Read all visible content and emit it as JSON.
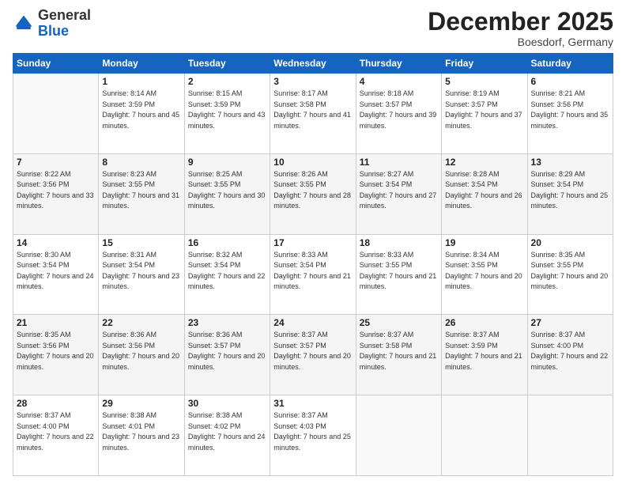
{
  "logo": {
    "general": "General",
    "blue": "Blue"
  },
  "header": {
    "month": "December 2025",
    "location": "Boesdorf, Germany"
  },
  "days_of_week": [
    "Sunday",
    "Monday",
    "Tuesday",
    "Wednesday",
    "Thursday",
    "Friday",
    "Saturday"
  ],
  "weeks": [
    [
      {
        "day": "",
        "sunrise": "",
        "sunset": "",
        "daylight": ""
      },
      {
        "day": "1",
        "sunrise": "Sunrise: 8:14 AM",
        "sunset": "Sunset: 3:59 PM",
        "daylight": "Daylight: 7 hours and 45 minutes."
      },
      {
        "day": "2",
        "sunrise": "Sunrise: 8:15 AM",
        "sunset": "Sunset: 3:59 PM",
        "daylight": "Daylight: 7 hours and 43 minutes."
      },
      {
        "day": "3",
        "sunrise": "Sunrise: 8:17 AM",
        "sunset": "Sunset: 3:58 PM",
        "daylight": "Daylight: 7 hours and 41 minutes."
      },
      {
        "day": "4",
        "sunrise": "Sunrise: 8:18 AM",
        "sunset": "Sunset: 3:57 PM",
        "daylight": "Daylight: 7 hours and 39 minutes."
      },
      {
        "day": "5",
        "sunrise": "Sunrise: 8:19 AM",
        "sunset": "Sunset: 3:57 PM",
        "daylight": "Daylight: 7 hours and 37 minutes."
      },
      {
        "day": "6",
        "sunrise": "Sunrise: 8:21 AM",
        "sunset": "Sunset: 3:56 PM",
        "daylight": "Daylight: 7 hours and 35 minutes."
      }
    ],
    [
      {
        "day": "7",
        "sunrise": "Sunrise: 8:22 AM",
        "sunset": "Sunset: 3:56 PM",
        "daylight": "Daylight: 7 hours and 33 minutes."
      },
      {
        "day": "8",
        "sunrise": "Sunrise: 8:23 AM",
        "sunset": "Sunset: 3:55 PM",
        "daylight": "Daylight: 7 hours and 31 minutes."
      },
      {
        "day": "9",
        "sunrise": "Sunrise: 8:25 AM",
        "sunset": "Sunset: 3:55 PM",
        "daylight": "Daylight: 7 hours and 30 minutes."
      },
      {
        "day": "10",
        "sunrise": "Sunrise: 8:26 AM",
        "sunset": "Sunset: 3:55 PM",
        "daylight": "Daylight: 7 hours and 28 minutes."
      },
      {
        "day": "11",
        "sunrise": "Sunrise: 8:27 AM",
        "sunset": "Sunset: 3:54 PM",
        "daylight": "Daylight: 7 hours and 27 minutes."
      },
      {
        "day": "12",
        "sunrise": "Sunrise: 8:28 AM",
        "sunset": "Sunset: 3:54 PM",
        "daylight": "Daylight: 7 hours and 26 minutes."
      },
      {
        "day": "13",
        "sunrise": "Sunrise: 8:29 AM",
        "sunset": "Sunset: 3:54 PM",
        "daylight": "Daylight: 7 hours and 25 minutes."
      }
    ],
    [
      {
        "day": "14",
        "sunrise": "Sunrise: 8:30 AM",
        "sunset": "Sunset: 3:54 PM",
        "daylight": "Daylight: 7 hours and 24 minutes."
      },
      {
        "day": "15",
        "sunrise": "Sunrise: 8:31 AM",
        "sunset": "Sunset: 3:54 PM",
        "daylight": "Daylight: 7 hours and 23 minutes."
      },
      {
        "day": "16",
        "sunrise": "Sunrise: 8:32 AM",
        "sunset": "Sunset: 3:54 PM",
        "daylight": "Daylight: 7 hours and 22 minutes."
      },
      {
        "day": "17",
        "sunrise": "Sunrise: 8:33 AM",
        "sunset": "Sunset: 3:54 PM",
        "daylight": "Daylight: 7 hours and 21 minutes."
      },
      {
        "day": "18",
        "sunrise": "Sunrise: 8:33 AM",
        "sunset": "Sunset: 3:55 PM",
        "daylight": "Daylight: 7 hours and 21 minutes."
      },
      {
        "day": "19",
        "sunrise": "Sunrise: 8:34 AM",
        "sunset": "Sunset: 3:55 PM",
        "daylight": "Daylight: 7 hours and 20 minutes."
      },
      {
        "day": "20",
        "sunrise": "Sunrise: 8:35 AM",
        "sunset": "Sunset: 3:55 PM",
        "daylight": "Daylight: 7 hours and 20 minutes."
      }
    ],
    [
      {
        "day": "21",
        "sunrise": "Sunrise: 8:35 AM",
        "sunset": "Sunset: 3:56 PM",
        "daylight": "Daylight: 7 hours and 20 minutes."
      },
      {
        "day": "22",
        "sunrise": "Sunrise: 8:36 AM",
        "sunset": "Sunset: 3:56 PM",
        "daylight": "Daylight: 7 hours and 20 minutes."
      },
      {
        "day": "23",
        "sunrise": "Sunrise: 8:36 AM",
        "sunset": "Sunset: 3:57 PM",
        "daylight": "Daylight: 7 hours and 20 minutes."
      },
      {
        "day": "24",
        "sunrise": "Sunrise: 8:37 AM",
        "sunset": "Sunset: 3:57 PM",
        "daylight": "Daylight: 7 hours and 20 minutes."
      },
      {
        "day": "25",
        "sunrise": "Sunrise: 8:37 AM",
        "sunset": "Sunset: 3:58 PM",
        "daylight": "Daylight: 7 hours and 21 minutes."
      },
      {
        "day": "26",
        "sunrise": "Sunrise: 8:37 AM",
        "sunset": "Sunset: 3:59 PM",
        "daylight": "Daylight: 7 hours and 21 minutes."
      },
      {
        "day": "27",
        "sunrise": "Sunrise: 8:37 AM",
        "sunset": "Sunset: 4:00 PM",
        "daylight": "Daylight: 7 hours and 22 minutes."
      }
    ],
    [
      {
        "day": "28",
        "sunrise": "Sunrise: 8:37 AM",
        "sunset": "Sunset: 4:00 PM",
        "daylight": "Daylight: 7 hours and 22 minutes."
      },
      {
        "day": "29",
        "sunrise": "Sunrise: 8:38 AM",
        "sunset": "Sunset: 4:01 PM",
        "daylight": "Daylight: 7 hours and 23 minutes."
      },
      {
        "day": "30",
        "sunrise": "Sunrise: 8:38 AM",
        "sunset": "Sunset: 4:02 PM",
        "daylight": "Daylight: 7 hours and 24 minutes."
      },
      {
        "day": "31",
        "sunrise": "Sunrise: 8:37 AM",
        "sunset": "Sunset: 4:03 PM",
        "daylight": "Daylight: 7 hours and 25 minutes."
      },
      {
        "day": "",
        "sunrise": "",
        "sunset": "",
        "daylight": ""
      },
      {
        "day": "",
        "sunrise": "",
        "sunset": "",
        "daylight": ""
      },
      {
        "day": "",
        "sunrise": "",
        "sunset": "",
        "daylight": ""
      }
    ]
  ]
}
